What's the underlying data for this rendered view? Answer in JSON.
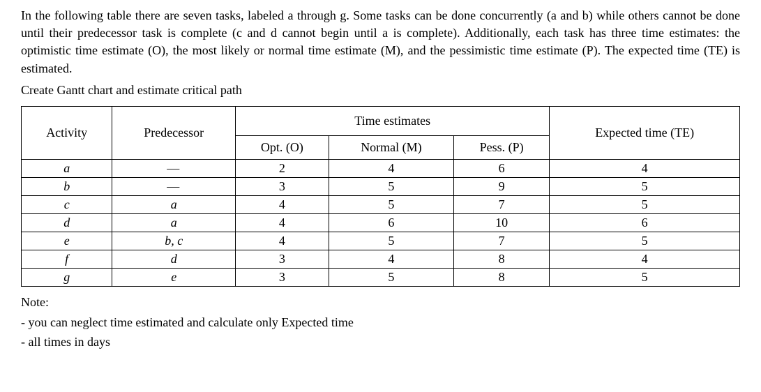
{
  "intro": "In the following table there are seven tasks, labeled a through g. Some tasks can be done concurrently (a and b) while others cannot be done until their predecessor task is complete (c and d cannot begin until a is complete). Additionally, each task has three time estimates: the optimistic time estimate (O), the most likely or normal time estimate (M), and the pessimistic time estimate (P). The expected time (TE) is estimated.",
  "instruction": "Create Gantt chart and estimate critical path",
  "headers": {
    "activity": "Activity",
    "predecessor": "Predecessor",
    "time_estimates": "Time estimates",
    "expected_time": "Expected time (TE)",
    "opt": "Opt. (O)",
    "normal": "Normal (M)",
    "pess": "Pess. (P)"
  },
  "rows": [
    {
      "activity": "a",
      "predecessor": "—",
      "opt": "2",
      "normal": "4",
      "pess": "6",
      "te": "4"
    },
    {
      "activity": "b",
      "predecessor": "—",
      "opt": "3",
      "normal": "5",
      "pess": "9",
      "te": "5"
    },
    {
      "activity": "c",
      "predecessor": "a",
      "opt": "4",
      "normal": "5",
      "pess": "7",
      "te": "5"
    },
    {
      "activity": "d",
      "predecessor": "a",
      "opt": "4",
      "normal": "6",
      "pess": "10",
      "te": "6"
    },
    {
      "activity": "e",
      "predecessor": "b, c",
      "opt": "4",
      "normal": "5",
      "pess": "7",
      "te": "5"
    },
    {
      "activity": "f",
      "predecessor": "d",
      "opt": "3",
      "normal": "4",
      "pess": "8",
      "te": "4"
    },
    {
      "activity": "g",
      "predecessor": "e",
      "opt": "3",
      "normal": "5",
      "pess": "8",
      "te": "5"
    }
  ],
  "note": {
    "label": "Note:",
    "item1": "- you can neglect time estimated and calculate only Expected time",
    "item2": "- all times in days"
  },
  "chart_data": {
    "type": "table",
    "title": "Task time estimates",
    "columns": [
      "Activity",
      "Predecessor",
      "Opt. (O)",
      "Normal (M)",
      "Pess. (P)",
      "Expected time (TE)"
    ],
    "data": [
      [
        "a",
        "—",
        2,
        4,
        6,
        4
      ],
      [
        "b",
        "—",
        3,
        5,
        9,
        5
      ],
      [
        "c",
        "a",
        4,
        5,
        7,
        5
      ],
      [
        "d",
        "a",
        4,
        6,
        10,
        6
      ],
      [
        "e",
        "b, c",
        4,
        5,
        7,
        5
      ],
      [
        "f",
        "d",
        3,
        4,
        8,
        4
      ],
      [
        "g",
        "e",
        3,
        5,
        8,
        5
      ]
    ]
  }
}
